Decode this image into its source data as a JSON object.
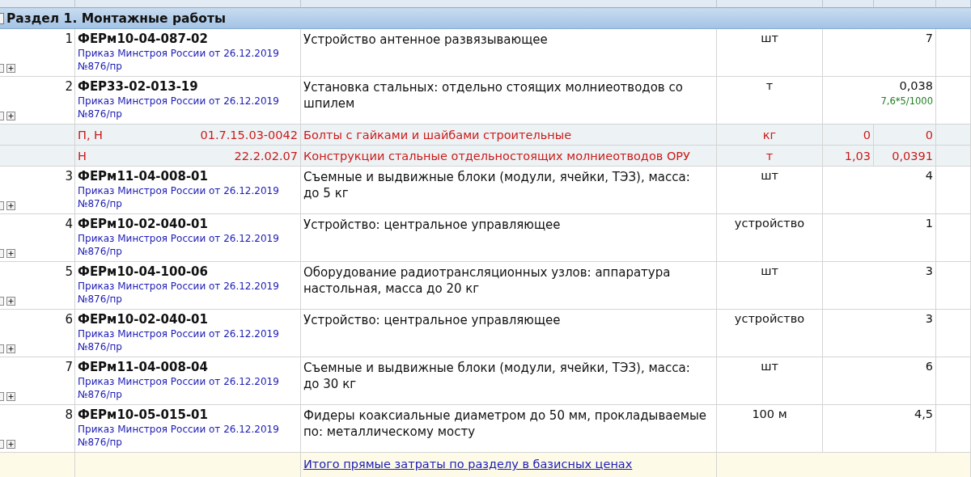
{
  "section": {
    "title": "Раздел 1. Монтажные работы"
  },
  "rows": [
    {
      "kind": "item",
      "number": "1",
      "code": "ФЕРм10-04-087-02",
      "source": "Приказ Минстроя России от 26.12.2019 №876/пр",
      "name": "Устройство антенное развязывающее",
      "unit": "шт",
      "quantity": "7"
    },
    {
      "kind": "item",
      "number": "2",
      "code": "ФЕР33-02-013-19",
      "source": "Приказ Минстроя России от 26.12.2019 №876/пр",
      "name": "Установка стальных: отдельно стоящих молниеотводов со шпилем",
      "unit": "т",
      "quantity": "0,038",
      "formula": "7,6*5/1000"
    },
    {
      "kind": "resource",
      "type": "П, Н",
      "code": "01.7.15.03-0042",
      "name": "Болты с гайками и шайбами строительные",
      "unit": "кг",
      "coefficient": "0",
      "quantity": "0"
    },
    {
      "kind": "resource",
      "type": "Н",
      "code": "22.2.02.07",
      "name": "Конструкции стальные отдельностоящих молниеотводов ОРУ",
      "unit": "т",
      "coefficient": "1,03",
      "quantity": "0,0391"
    },
    {
      "kind": "item",
      "number": "3",
      "code": "ФЕРм11-04-008-01",
      "source": "Приказ Минстроя России от 26.12.2019 №876/пр",
      "name": "Съемные и выдвижные блоки (модули, ячейки, ТЭЗ), масса: до 5 кг",
      "unit": "шт",
      "quantity": "4"
    },
    {
      "kind": "item",
      "number": "4",
      "code": "ФЕРм10-02-040-01",
      "source": "Приказ Минстроя России от 26.12.2019 №876/пр",
      "name": "Устройство: центральное управляющее",
      "unit": "устройство",
      "quantity": "1"
    },
    {
      "kind": "item",
      "number": "5",
      "code": "ФЕРм10-04-100-06",
      "source": "Приказ Минстроя России от 26.12.2019 №876/пр",
      "name": "Оборудование радиотрансляционных узлов: аппаратура настольная, масса до 20 кг",
      "unit": "шт",
      "quantity": "3"
    },
    {
      "kind": "item",
      "number": "6",
      "code": "ФЕРм10-02-040-01",
      "source": "Приказ Минстроя России от 26.12.2019 №876/пр",
      "name": "Устройство: центральное управляющее",
      "unit": "устройство",
      "quantity": "3"
    },
    {
      "kind": "item",
      "number": "7",
      "code": "ФЕРм11-04-008-04",
      "source": "Приказ Минстроя России от 26.12.2019 №876/пр",
      "name": "Съемные и выдвижные блоки (модули, ячейки, ТЭЗ), масса: до 30 кг",
      "unit": "шт",
      "quantity": "6"
    },
    {
      "kind": "item",
      "number": "8",
      "code": "ФЕРм10-05-015-01",
      "source": "Приказ Минстроя России от 26.12.2019 №876/пр",
      "name": "Фидеры коаксиальные диаметром до 50 мм, прокладываемые по: металлическому мосту",
      "unit": "100 м",
      "quantity": "4,5"
    }
  ],
  "footer": {
    "text": "Итого прямые затраты по разделу в базисных ценах"
  }
}
